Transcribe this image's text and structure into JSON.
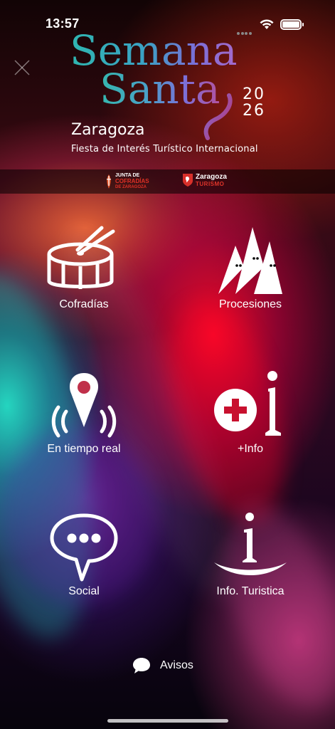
{
  "status_bar": {
    "time": "13:57",
    "battery_level": 1.0,
    "icons": [
      "cellular-dots-icon",
      "wifi-icon",
      "battery-icon"
    ]
  },
  "header": {
    "close_icon": "close-icon",
    "logo": {
      "line1": "Semana",
      "line2": "Santa",
      "year_top": "20",
      "year_bottom": "26",
      "city": "Zaragoza",
      "subtitle": "Fiesta de Interés Turístico Internacional"
    },
    "sponsors": [
      {
        "line1": "Junta de",
        "line2": "Cofradías",
        "line3": "de Zaragoza"
      },
      {
        "line1": "Zaragoza",
        "line2": "TURISMO"
      }
    ]
  },
  "menu": {
    "items": [
      {
        "label": "Cofradías",
        "icon": "drum-icon"
      },
      {
        "label": "Procesiones",
        "icon": "nazarenos-icon"
      },
      {
        "label": "En tiempo real",
        "icon": "live-location-icon"
      },
      {
        "label": "+Info",
        "icon": "plus-info-icon"
      },
      {
        "label": "Social",
        "icon": "chat-bubble-icon"
      },
      {
        "label": "Info. Turistica",
        "icon": "tourist-info-icon"
      }
    ]
  },
  "footer": {
    "avisos_label": "Avisos",
    "avisos_icon": "speech-bubble-icon"
  },
  "colors": {
    "accent_teal": "#2fb6b0",
    "accent_purple": "#7a6fd8",
    "sponsor_red": "#e03025"
  }
}
